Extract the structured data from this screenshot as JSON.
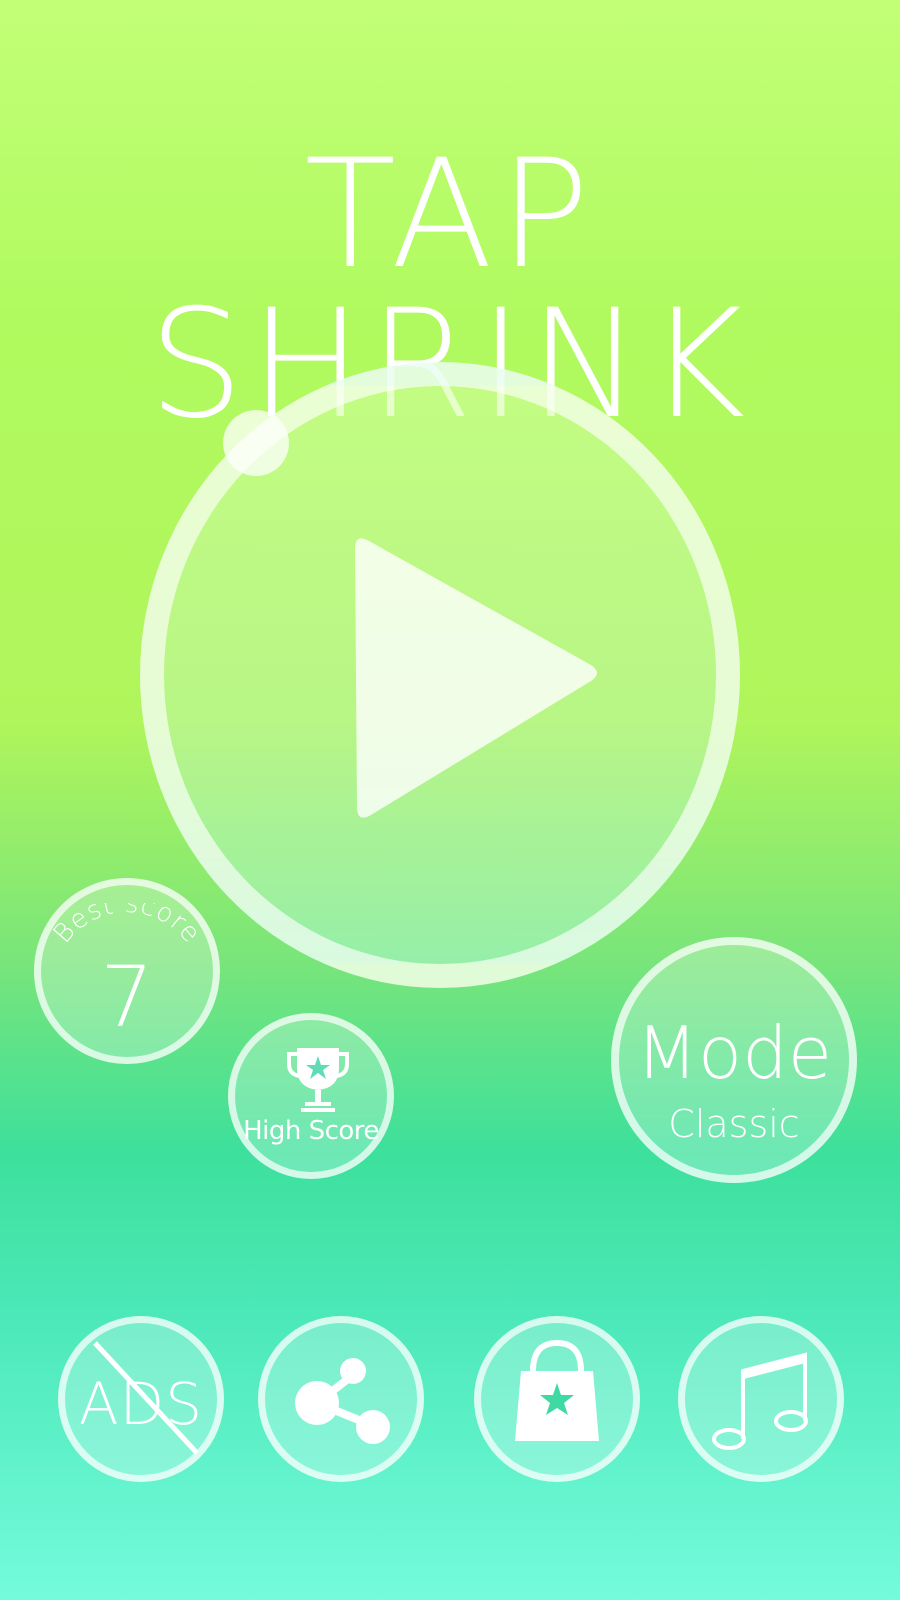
{
  "title": "TAP SHRINK",
  "play": {
    "icon": "play-icon"
  },
  "best_score": {
    "label": "Best score",
    "value": "7"
  },
  "high_score_button": {
    "icon": "trophy-star-icon",
    "label": "High Score"
  },
  "mode": {
    "title": "Mode",
    "value": "Classic"
  },
  "bottom_bar": {
    "no_ads": {
      "icon": "no-ads-icon",
      "text": "ADS"
    },
    "share": {
      "icon": "share-icon"
    },
    "shop": {
      "icon": "shopping-bag-star-icon"
    },
    "music": {
      "icon": "music-note-icon"
    }
  },
  "colors": {
    "background_top": "#c2ff77",
    "background_middle": "#3de09c",
    "background_bottom": "#74fbdc",
    "foreground": "#ffffff"
  }
}
